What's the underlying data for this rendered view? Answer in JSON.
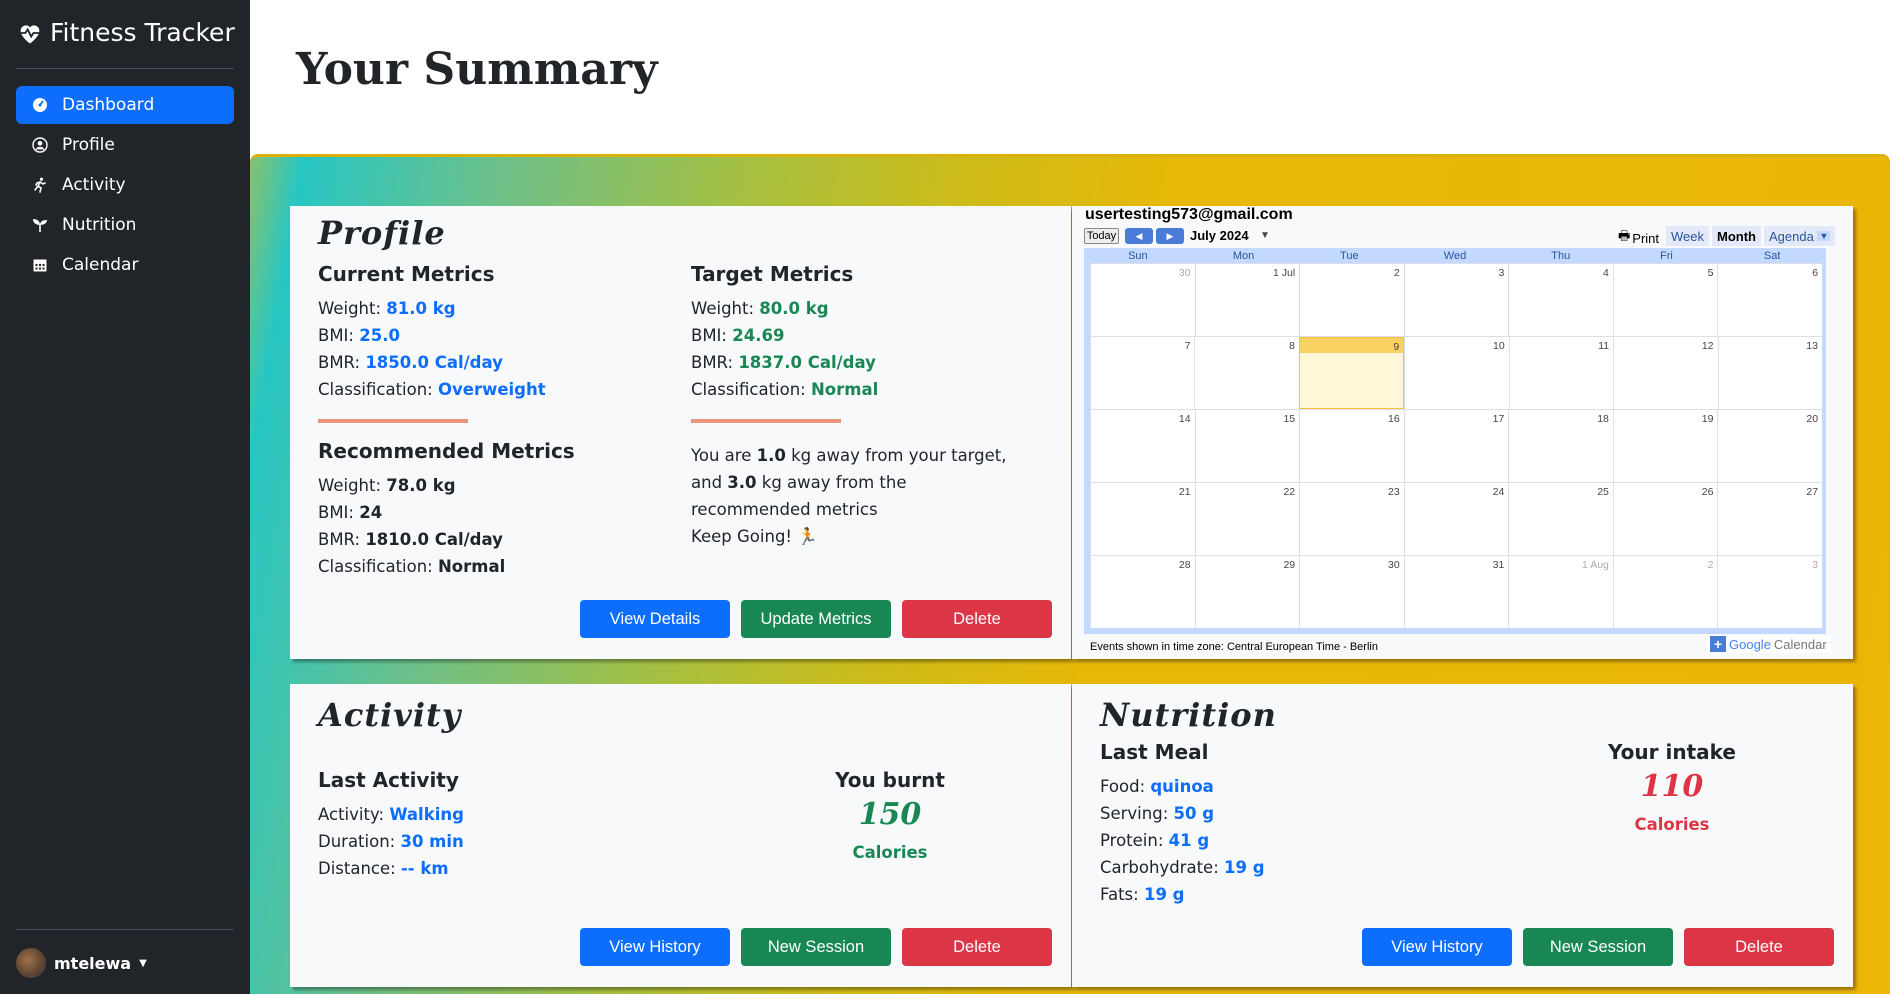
{
  "app": {
    "title": "Fitness Tracker"
  },
  "sidebar": {
    "items": [
      {
        "label": "Dashboard",
        "icon": "dashboard-icon"
      },
      {
        "label": "Profile",
        "icon": "person-icon"
      },
      {
        "label": "Activity",
        "icon": "running-icon"
      },
      {
        "label": "Nutrition",
        "icon": "sprout-icon"
      },
      {
        "label": "Calendar",
        "icon": "calendar-icon"
      }
    ],
    "user": "mtelewa"
  },
  "page": {
    "title": "Your Summary"
  },
  "profile": {
    "title": "Profile",
    "current": {
      "heading": "Current Metrics",
      "weight_label": "Weight: ",
      "weight": "81.0 kg",
      "bmi_label": "BMI: ",
      "bmi": "25.0",
      "bmr_label": "BMR: ",
      "bmr": "1850.0 Cal/day",
      "class_label": "Classification: ",
      "classification": "Overweight"
    },
    "target": {
      "heading": "Target Metrics",
      "weight_label": "Weight: ",
      "weight": "80.0 kg",
      "bmi_label": "BMI: ",
      "bmi": "24.69",
      "bmr_label": "BMR: ",
      "bmr": "1837.0 Cal/day",
      "class_label": "Classification: ",
      "classification": "Normal"
    },
    "recommended": {
      "heading": "Recommended Metrics",
      "weight_label": "Weight: ",
      "weight": "78.0 kg",
      "bmi_label": "BMI: ",
      "bmi": "24",
      "bmr_label": "BMR: ",
      "bmr": "1810.0 Cal/day",
      "class_label": "Classification: ",
      "classification": "Normal"
    },
    "message": {
      "p1": "You are ",
      "v1": "1.0",
      "p2": " kg away from your target,",
      "p3": "and ",
      "v2": "3.0",
      "p4": " kg away from the recommended metrics",
      "p5": "Keep Going! "
    },
    "buttons": {
      "details": "View Details",
      "update": "Update Metrics",
      "delete": "Delete"
    }
  },
  "calendar": {
    "email": "usertesting573@gmail.com",
    "today": "Today",
    "month": "July 2024",
    "print": "Print",
    "tabs": {
      "week": "Week",
      "month": "Month",
      "agenda": "Agenda"
    },
    "days": [
      "Sun",
      "Mon",
      "Tue",
      "Wed",
      "Thu",
      "Fri",
      "Sat"
    ],
    "weeks": [
      [
        "30",
        "1 Jul",
        "2",
        "3",
        "4",
        "5",
        "6"
      ],
      [
        "7",
        "8",
        "9",
        "10",
        "11",
        "12",
        "13"
      ],
      [
        "14",
        "15",
        "16",
        "17",
        "18",
        "19",
        "20"
      ],
      [
        "21",
        "22",
        "23",
        "24",
        "25",
        "26",
        "27"
      ],
      [
        "28",
        "29",
        "30",
        "31",
        "1 Aug",
        "2",
        "3"
      ]
    ],
    "footer": "Events shown in time zone: Central European Time - Berlin",
    "brand_google": "Google",
    "brand_calendar": "Calendar"
  },
  "activity": {
    "title": "Activity",
    "heading": "Last Activity",
    "activity_label": "Activity: ",
    "activity": "Walking",
    "duration_label": "Duration: ",
    "duration": "30 min",
    "distance_label": "Distance: ",
    "distance": "-- km",
    "burnt_label": "You burnt",
    "burnt": "150",
    "unit": "Calories",
    "buttons": {
      "history": "View History",
      "session": "New Session",
      "delete": "Delete"
    }
  },
  "nutrition": {
    "title": "Nutrition",
    "heading": "Last Meal",
    "food_label": "Food: ",
    "food": "quinoa",
    "serving_label": "Serving: ",
    "serving": "50 g",
    "protein_label": "Protein: ",
    "protein": "41 g",
    "carb_label": "Carbohydrate: ",
    "carb": "19 g",
    "fats_label": "Fats: ",
    "fats": "19 g",
    "intake_label": "Your intake",
    "intake": "110",
    "unit": "Calories",
    "buttons": {
      "history": "View History",
      "session": "New Session",
      "delete": "Delete"
    }
  },
  "colors": {
    "primary": "#0d6efd",
    "success": "#198754",
    "danger": "#dc3545",
    "sidebar": "#212529"
  }
}
